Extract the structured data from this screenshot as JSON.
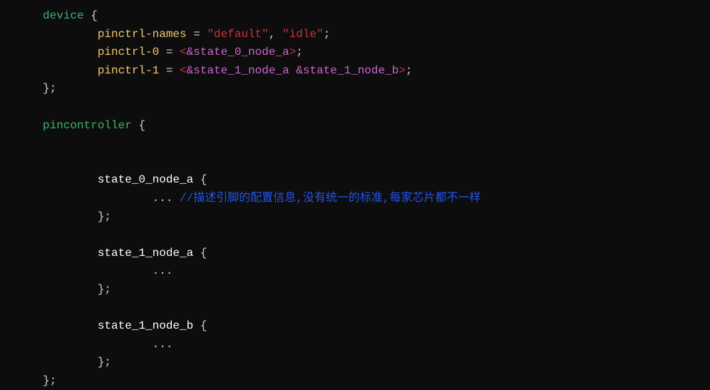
{
  "code": {
    "line1_kw": "device",
    "line1_brace": " {",
    "line2_prop": "pinctrl-names",
    "line2_eq": " = ",
    "line2_str1": "\"default\"",
    "line2_comma": ", ",
    "line2_str2": "\"idle\"",
    "line2_semi": ";",
    "line3_prop": "pinctrl-0",
    "line3_eq": " = ",
    "line3_lt": "<",
    "line3_ref": "&state_0_node_a",
    "line3_gt": ">",
    "line3_semi": ";",
    "line4_prop": "pinctrl-1",
    "line4_eq": " = ",
    "line4_lt": "<",
    "line4_ref1": "&state_1_node_a ",
    "line4_ref2": "&state_1_node_b",
    "line4_gt": ">",
    "line4_semi": ";",
    "line5_close": "};",
    "line7_kw": "pincontroller",
    "line7_brace": " {",
    "line10_label": "state_0_node_a",
    "line10_brace": " {",
    "line11_dots": "... ",
    "line11_comment": "//描述引脚的配置信息,没有统一的标准,每家芯片都不一样",
    "line12_close": "};",
    "line14_label": "state_1_node_a",
    "line14_brace": " {",
    "line15_dots": "...",
    "line16_close": "};",
    "line18_label": "state_1_node_b",
    "line18_brace": " {",
    "line19_dots": "...",
    "line20_close": "};",
    "line21_close": "};"
  }
}
